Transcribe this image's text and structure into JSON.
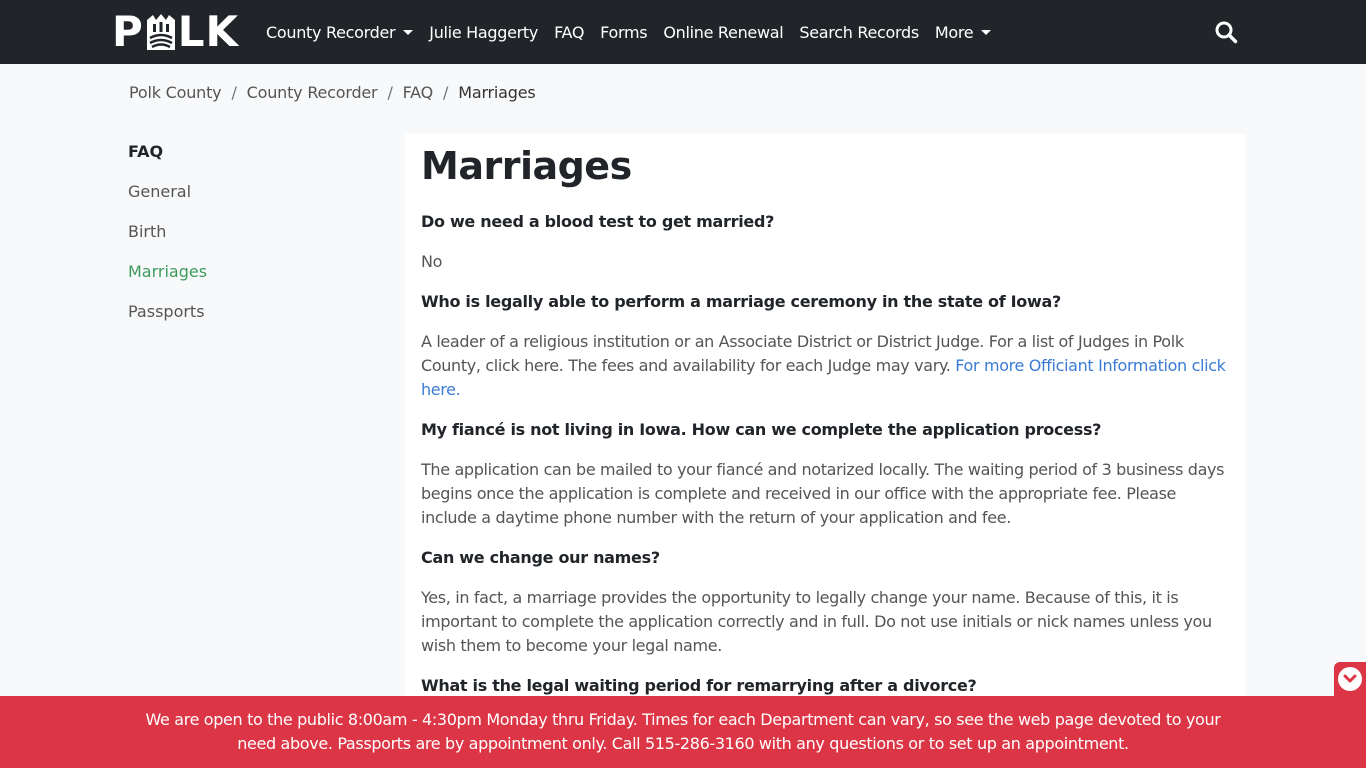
{
  "header": {
    "logo_text_left": "P",
    "logo_text_right": "LK",
    "nav": [
      {
        "label": "County Recorder",
        "dropdown": true
      },
      {
        "label": "Julie Haggerty",
        "dropdown": false
      },
      {
        "label": "FAQ",
        "dropdown": false
      },
      {
        "label": "Forms",
        "dropdown": false
      },
      {
        "label": "Online Renewal",
        "dropdown": false
      },
      {
        "label": "Search Records",
        "dropdown": false
      },
      {
        "label": "More",
        "dropdown": true
      }
    ],
    "search_icon": "search-icon"
  },
  "breadcrumb": {
    "items": [
      "Polk County",
      "County Recorder",
      "FAQ"
    ],
    "separator": "/",
    "active": "Marriages"
  },
  "sidebar": {
    "heading": "FAQ",
    "items": [
      {
        "label": "General",
        "active": false
      },
      {
        "label": "Birth",
        "active": false
      },
      {
        "label": "Marriages",
        "active": true
      },
      {
        "label": "Passports",
        "active": false
      }
    ]
  },
  "main": {
    "title": "Marriages",
    "faq": [
      {
        "q": "Do we need a blood test to get married?",
        "a": "No"
      },
      {
        "q": "Who is legally able to perform a marriage ceremony in the state of Iowa?",
        "a": "A leader of a religious institution or an Associate District or District Judge. For a list of Judges in Polk County, click here. The fees and availability for each Judge may vary. ",
        "link": "For more Officiant Information click here."
      },
      {
        "q": "My fiancé is not living in Iowa.  How can we complete the application process?",
        "a": "The application can be mailed to your fiancé and notarized locally. The waiting period of 3 business days begins once the application is complete and received in our office with the appropriate fee. Please include a daytime phone number with the return of your application and fee."
      },
      {
        "q": "Can we change our names?",
        "a": "Yes, in fact, a marriage provides the opportunity to legally change your name. Because of this, it is important to complete the application correctly and in full. Do not use initials or nick names unless you wish them to become your legal name."
      },
      {
        "q": "What is the legal waiting period for remarrying after a divorce?",
        "a": ""
      }
    ]
  },
  "banner": {
    "text": "We are open to the public 8:00am - 4:30pm Monday thru Friday. Times for each Department can vary, so see the web page devoted to your need above. Passports are by appointment only. Call 515-286-3160 with any questions or to set up an appointment."
  },
  "colors": {
    "navbar": "#212529",
    "link": "#3a7bd5",
    "active_side": "#3d9b5c",
    "banner": "#dc3545"
  }
}
